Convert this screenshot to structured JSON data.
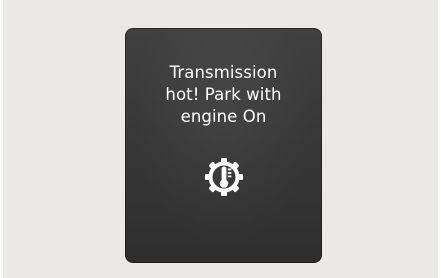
{
  "warning": {
    "lines": [
      "Transmission",
      "hot! Park with",
      "engine On"
    ],
    "icon": "transmission-temperature-gear-icon"
  },
  "colors": {
    "background": "#ebe8e8",
    "panel": "#383838",
    "text": "#ffffff",
    "icon": "#ffffff"
  }
}
